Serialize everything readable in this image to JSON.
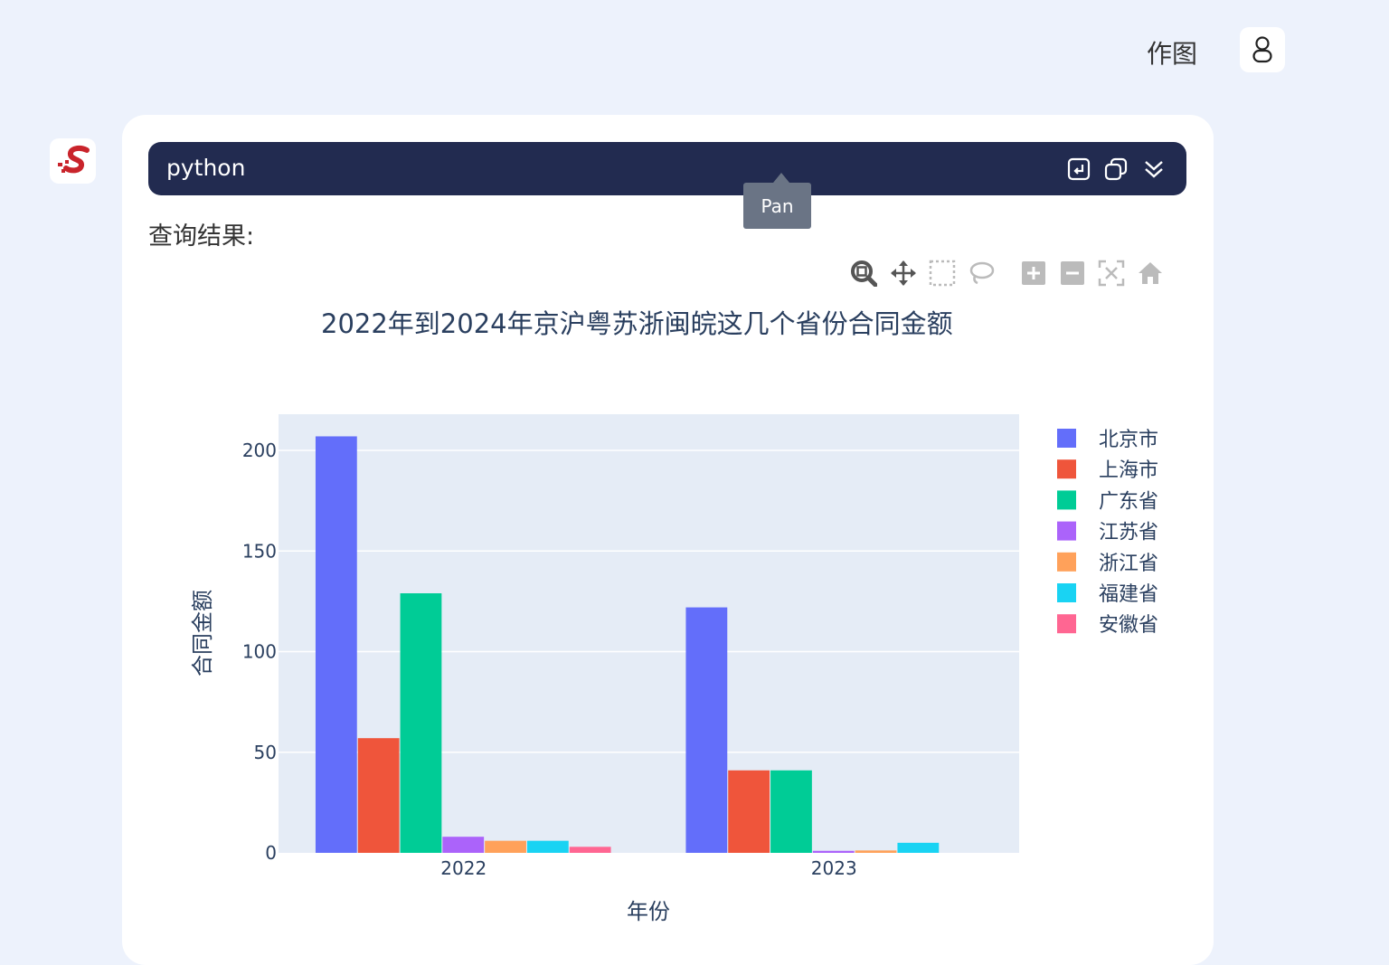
{
  "header": {
    "nav_label": "作图"
  },
  "code_block": {
    "language": "python"
  },
  "result_label": "查询结果:",
  "tooltip": "Pan",
  "colors": {
    "page_bg": "#edf2fc",
    "code_header_bg": "#222b50",
    "plot_bg": "#e5ecf6",
    "logo_red": "#c9242b"
  },
  "modebar": [
    "zoom-icon",
    "pan-icon",
    "box-select-icon",
    "lasso-select-icon",
    "zoom-in-icon",
    "zoom-out-icon",
    "autoscale-icon",
    "reset-axes-icon"
  ],
  "chart_data": {
    "type": "bar",
    "title": "2022年到2024年京沪粤苏浙闽皖这几个省份合同金额",
    "xlabel": "年份",
    "ylabel": "合同金额",
    "categories": [
      "2022",
      "2023"
    ],
    "ylim": [
      0,
      218
    ],
    "yticks": [
      0,
      50,
      100,
      150,
      200
    ],
    "grid": true,
    "legend_position": "right",
    "series": [
      {
        "name": "北京市",
        "color": "#636efa",
        "values": [
          207,
          122
        ]
      },
      {
        "name": "上海市",
        "color": "#ef553b",
        "values": [
          57,
          41
        ]
      },
      {
        "name": "广东省",
        "color": "#00cc96",
        "values": [
          129,
          41
        ]
      },
      {
        "name": "江苏省",
        "color": "#ab63fa",
        "values": [
          8,
          1
        ]
      },
      {
        "name": "浙江省",
        "color": "#ffa15a",
        "values": [
          6,
          1.2
        ]
      },
      {
        "name": "福建省",
        "color": "#19d3f3",
        "values": [
          6,
          5
        ]
      },
      {
        "name": "安徽省",
        "color": "#ff6692",
        "values": [
          3,
          0
        ]
      }
    ]
  }
}
